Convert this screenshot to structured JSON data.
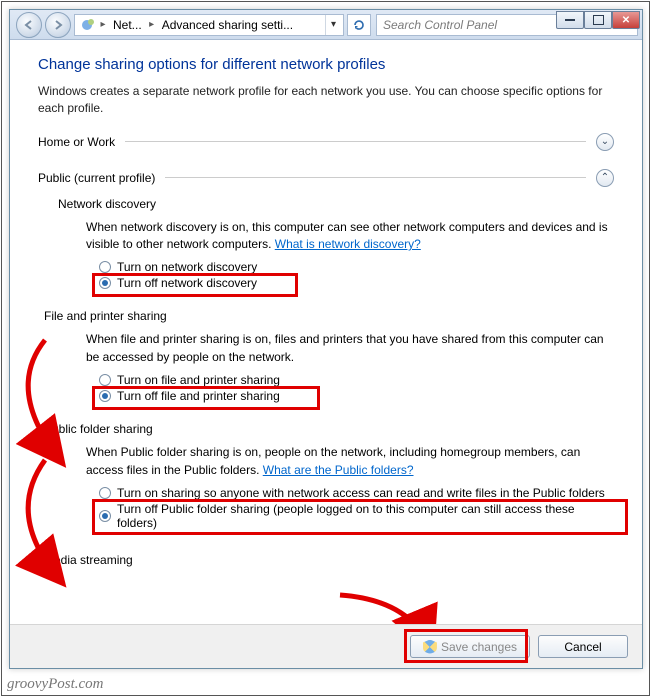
{
  "titlebar": {
    "breadcrumb_part1": "Net...",
    "breadcrumb_part2": "Advanced sharing setti...",
    "search_placeholder": "Search Control Panel"
  },
  "header": {
    "title": "Change sharing options for different network profiles",
    "desc": "Windows creates a separate network profile for each network you use. You can choose specific options for each profile."
  },
  "profile_home_label": "Home or Work",
  "profile_public_label": "Public (current profile)",
  "sections": {
    "net_discovery": {
      "title": "Network discovery",
      "desc": "When network discovery is on, this computer can see other network computers and devices and is visible to other network computers. ",
      "link": "What is network discovery?",
      "opt_on": "Turn on network discovery",
      "opt_off": "Turn off network discovery"
    },
    "file_printer": {
      "title": "File and printer sharing",
      "desc": "When file and printer sharing is on, files and printers that you have shared from this computer can be accessed by people on the network.",
      "opt_on": "Turn on file and printer sharing",
      "opt_off": "Turn off file and printer sharing"
    },
    "public_folder": {
      "title": "Public folder sharing",
      "desc": "When Public folder sharing is on, people on the network, including homegroup members, can access files in the Public folders. ",
      "link": "What are the Public folders?",
      "opt_on": "Turn on sharing so anyone with network access can read and write files in the Public folders",
      "opt_off": "Turn off Public folder sharing (people logged on to this computer can still access these folders)"
    },
    "media_streaming": {
      "title": "Media streaming"
    }
  },
  "footer": {
    "save": "Save changes",
    "cancel": "Cancel"
  },
  "watermark": "groovyPost.com"
}
